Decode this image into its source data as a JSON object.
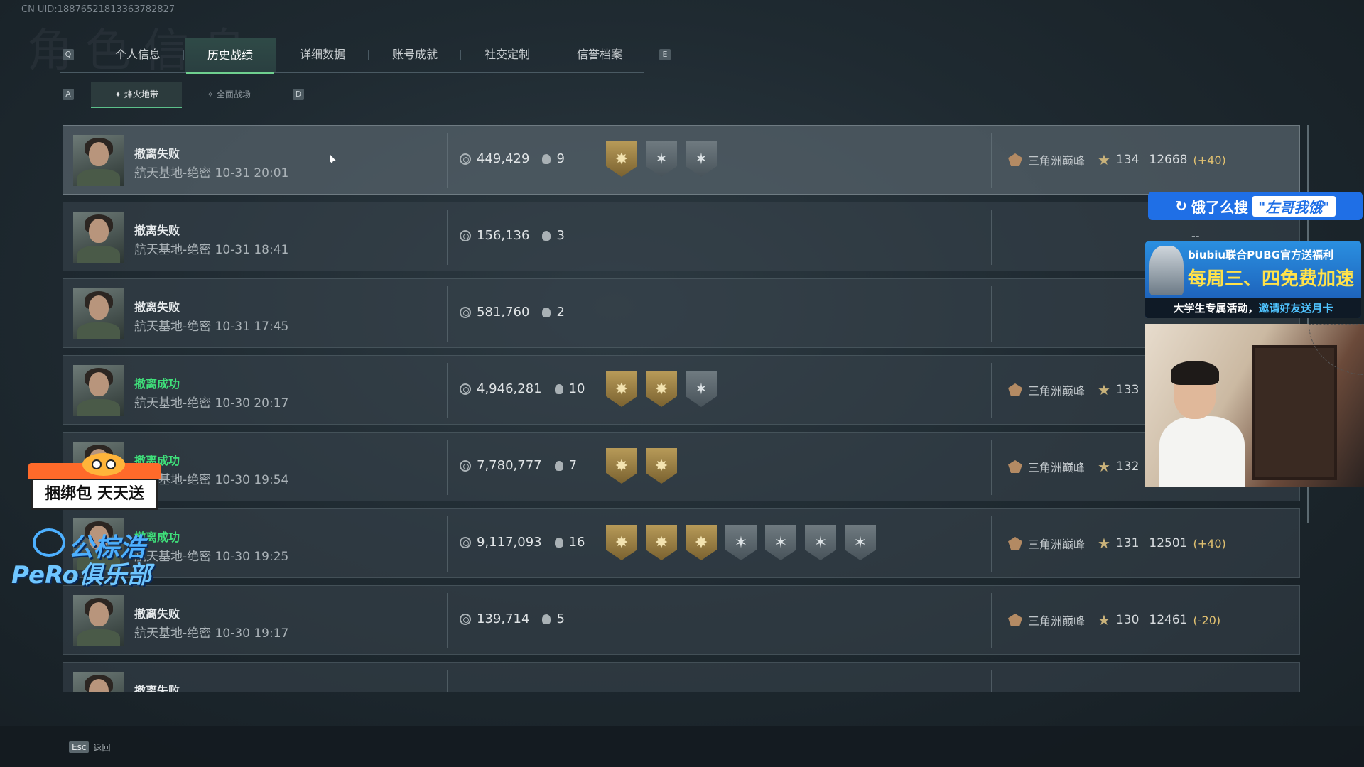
{
  "uid": "CN UID:18876521813363782827",
  "bg_title": "角色信息",
  "tabs": {
    "key_left": "Q",
    "key_right": "E",
    "items": [
      {
        "label": "个人信息",
        "active": false
      },
      {
        "label": "历史战绩",
        "active": true
      },
      {
        "label": "详细数据",
        "active": false
      },
      {
        "label": "账号成就",
        "active": false
      },
      {
        "label": "社交定制",
        "active": false
      },
      {
        "label": "信誉档案",
        "active": false
      }
    ]
  },
  "subtabs": {
    "key_left": "A",
    "key_right": "D",
    "items": [
      {
        "label": "烽火地带",
        "active": true
      },
      {
        "label": "全面战场",
        "active": false
      }
    ]
  },
  "matches": [
    {
      "status": "撤离失败",
      "success": false,
      "info": "航天基地-绝密 10-31 20:01",
      "money": "449,429",
      "kills": "9",
      "medals": [
        "gold",
        "gray",
        "gray"
      ],
      "rank_name": "三角洲巅峰",
      "level": "134",
      "score": "12668",
      "delta": "(+40)",
      "highlight": true
    },
    {
      "status": "撤离失败",
      "success": false,
      "info": "航天基地-绝密 10-31 18:41",
      "money": "156,136",
      "kills": "3",
      "medals": [],
      "rank_name": "",
      "level": "",
      "score": "",
      "delta": "",
      "dash": "--"
    },
    {
      "status": "撤离失败",
      "success": false,
      "info": "航天基地-绝密 10-31 17:45",
      "money": "581,760",
      "kills": "2",
      "medals": [],
      "rank_name": "",
      "level": "",
      "score": "",
      "delta": "",
      "dash": "--"
    },
    {
      "status": "撤离成功",
      "success": true,
      "info": "航天基地-绝密 10-30 20:17",
      "money": "4,946,281",
      "kills": "10",
      "medals": [
        "gold",
        "gold",
        "gray"
      ],
      "rank_name": "三角洲巅峰",
      "level": "133",
      "score": "",
      "delta": ""
    },
    {
      "status": "撤离成功",
      "success": true,
      "info": "航天基地-绝密 10-30 19:54",
      "money": "7,780,777",
      "kills": "7",
      "medals": [
        "gold",
        "gold"
      ],
      "rank_name": "三角洲巅峰",
      "level": "132",
      "score": "",
      "delta": ""
    },
    {
      "status": "撤离成功",
      "success": true,
      "info": "航天基地-绝密 10-30 19:25",
      "money": "9,117,093",
      "kills": "16",
      "medals": [
        "gold",
        "gold",
        "gold",
        "gray",
        "gray",
        "gray",
        "gray"
      ],
      "rank_name": "三角洲巅峰",
      "level": "131",
      "score": "12501",
      "delta": "(+40)"
    },
    {
      "status": "撤离失败",
      "success": false,
      "info": "航天基地-绝密 10-30 19:17",
      "money": "139,714",
      "kills": "5",
      "medals": [],
      "rank_name": "三角洲巅峰",
      "level": "130",
      "score": "12461",
      "delta": "(-20)"
    },
    {
      "status": "撤离失败",
      "success": false,
      "info": "",
      "money": "",
      "kills": "",
      "medals": [],
      "rank_name": "",
      "level": "",
      "score": "",
      "delta": ""
    }
  ],
  "footer": {
    "key": "Esc",
    "label": "返回"
  },
  "overlays": {
    "search_ad": {
      "prefix": "饿了么搜",
      "query": "\"左哥我饿\""
    },
    "pubg_ad": {
      "line1": "biubiu联合PUBG官方送福利",
      "line2": "每周三、四免费加速",
      "line3_a": "大学生专属活动，",
      "line3_b": "邀请好友送月卡"
    },
    "bundle_ad": {
      "text": "捆绑包 天天送"
    },
    "club": {
      "line1": "公棕浩",
      "line2": "PeRo俱乐部"
    }
  },
  "colors": {
    "accent": "#5cc08a",
    "success": "#3fe07a",
    "gold_medal": "#b79a58",
    "ad_blue": "#1f6fe6"
  }
}
